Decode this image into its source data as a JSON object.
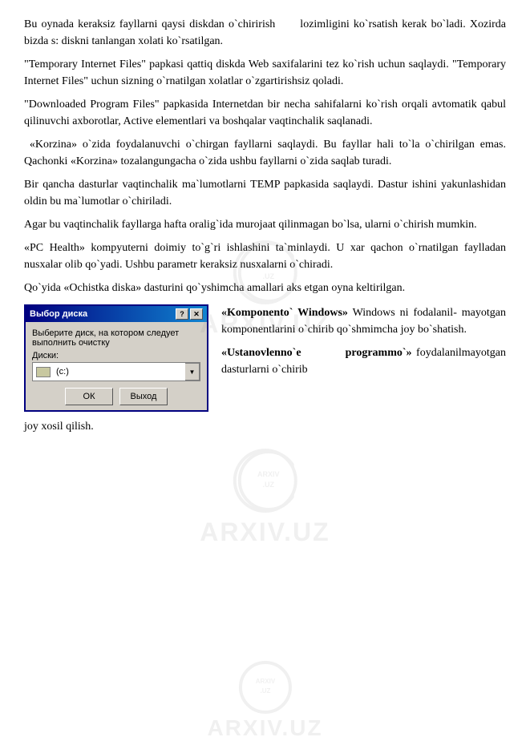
{
  "page": {
    "paragraphs": [
      {
        "id": "p1",
        "text": " Bu oynada keraksiz fayllarni qaysi diskdan o`chirirish     lozimligini  ko`rsatish kerak bo`ladi. Xozirda bizda s: diskni tanlangan xolati ko`rsatilgan."
      },
      {
        "id": "p2",
        "text": "\"Temporary Internet Files\" papkasi qattiq diskda Web saxifalarini tez ko`rish  uchun  saqlaydi.  \"Temporary  Internet  Files\"  uchun  sizning o`rnatilgan xolatlar o`zgartirishsiz qoladi."
      },
      {
        "id": "p3",
        "text": "\"Downloaded Program Files\" papkasida Internetdan bir necha sahifalarni ko`rish orqali  avtomatik  qabul  qilinuvchi  axborotlar,  Active  elementlari  va  boshqalar vaqtinchalik saqlanadi."
      },
      {
        "id": "p4",
        "text": " «Korzina» o`zida foydalanuvchi o`chirgan fayllarni saqlaydi. Bu fayllar hali to`la o`chirilgan  emas.  Qachonki  «Korzina»  tozalangungacha  o`zida  ushbu  fayllarni o`zida saqlab turadi."
      },
      {
        "id": "p5",
        "text": "Bir qancha dasturlar vaqtinchalik ma`lumotlarni TEMP papkasida saqlaydi. Dastur ishini yakunlashidan oldin bu ma`lumotlar o`chiriladi."
      },
      {
        "id": "p6",
        "text": "Agar bu vaqtinchalik fayllarga hafta oralig`ida murojaat qilinmagan bo`lsa, ularni o`chirish mumkin."
      },
      {
        "id": "p7",
        "text": "«PC  Health»  kompyuterni  doimiy  to`g`ri  ishlashini  ta`minlaydi.  U  xar  qachon o`rnatilgan  faylladan  nusxalar  olib  qo`yadi.  Ushbu  parametr  keraksiz  nusxalarni o`chiradi."
      },
      {
        "id": "p8",
        "text": "Qo`yida  «Ochistka  diska»  dasturini  qo`yshimcha  amallari  aks  etgan  oyna keltirilgan."
      }
    ],
    "dialog": {
      "title": "Выбор диска",
      "title_buttons": [
        "?",
        "×"
      ],
      "label": "Выберите диск, на котором следует выполнить очистку",
      "field_label": "Диски:",
      "drive_value": "(c:)",
      "ok_button": "ОК",
      "cancel_button": "Выход"
    },
    "dialog_right_text": {
      "line1": "«Komponento`  Windows»  Windows ni fodalanil- mayotgan komponentlarini o`chirib qo`shmimcha joy bo`shatish.",
      "line2": "«Ustanovlenno`e          programmo`» foydalanilmayotgan dasturlarni o`chirib joy xosil qilish."
    },
    "footer_text": "joy xosil qilish.",
    "watermarks": [
      "ARXIV.UZ",
      "ARXIV.UZ"
    ]
  }
}
